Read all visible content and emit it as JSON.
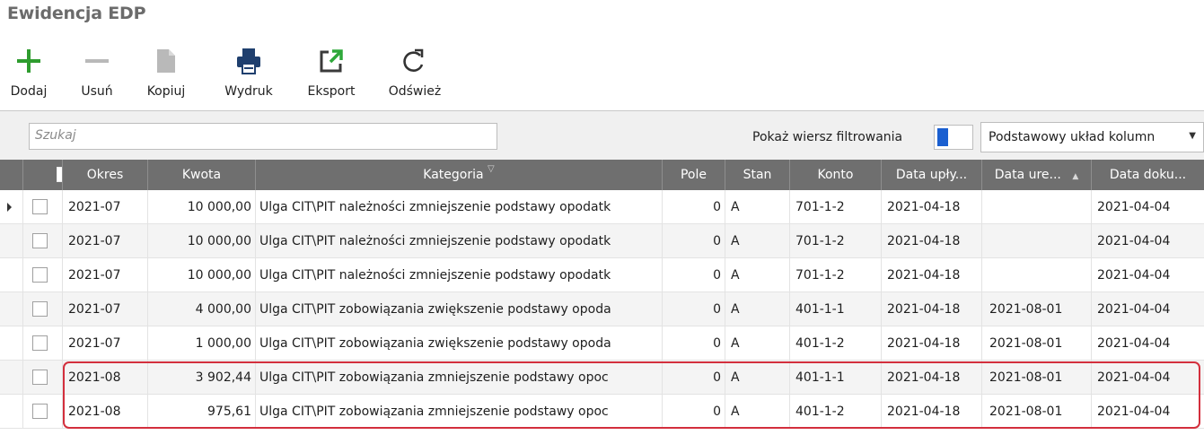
{
  "title": "Ewidencja EDP",
  "toolbar": {
    "add_label": "Dodaj",
    "delete_label": "Usuń",
    "copy_label": "Kopiuj",
    "print_label": "Wydruk",
    "export_label": "Eksport",
    "refresh_label": "Odśwież"
  },
  "search": {
    "placeholder": "Szukaj"
  },
  "filter": {
    "label": "Pokaż wiersz filtrowania"
  },
  "layout": {
    "selected": "Podstawowy układ kolumn"
  },
  "columns": {
    "okres": "Okres",
    "kwota": "Kwota",
    "kategoria": "Kategoria",
    "pole": "Pole",
    "stan": "Stan",
    "konto": "Konto",
    "data_uply": "Data upły...",
    "data_ure": "Data ure...",
    "data_doku": "Data doku..."
  },
  "rows": [
    {
      "okres": "2021-07",
      "kwota": "10 000,00",
      "kategoria": "Ulga CIT\\PIT należności zmniejszenie podstawy opodatk",
      "pole": "0",
      "stan": "A",
      "konto": "701-1-2",
      "data_uply": "2021-04-18",
      "data_ure": "",
      "data_doku": "2021-04-04"
    },
    {
      "okres": "2021-07",
      "kwota": "10 000,00",
      "kategoria": "Ulga CIT\\PIT należności zmniejszenie podstawy opodatk",
      "pole": "0",
      "stan": "A",
      "konto": "701-1-2",
      "data_uply": "2021-04-18",
      "data_ure": "",
      "data_doku": "2021-04-04"
    },
    {
      "okres": "2021-07",
      "kwota": "10 000,00",
      "kategoria": "Ulga CIT\\PIT należności zmniejszenie podstawy opodatk",
      "pole": "0",
      "stan": "A",
      "konto": "701-1-2",
      "data_uply": "2021-04-18",
      "data_ure": "",
      "data_doku": "2021-04-04"
    },
    {
      "okres": "2021-07",
      "kwota": "4 000,00",
      "kategoria": "Ulga CIT\\PIT zobowiązania zwiększenie podstawy opoda",
      "pole": "0",
      "stan": "A",
      "konto": "401-1-1",
      "data_uply": "2021-04-18",
      "data_ure": "2021-08-01",
      "data_doku": "2021-04-04"
    },
    {
      "okres": "2021-07",
      "kwota": "1 000,00",
      "kategoria": "Ulga CIT\\PIT zobowiązania zwiększenie podstawy opoda",
      "pole": "0",
      "stan": "A",
      "konto": "401-1-2",
      "data_uply": "2021-04-18",
      "data_ure": "2021-08-01",
      "data_doku": "2021-04-04"
    },
    {
      "okres": "2021-08",
      "kwota": "3 902,44",
      "kategoria": "Ulga CIT\\PIT zobowiązania zmniejszenie podstawy opoc",
      "pole": "0",
      "stan": "A",
      "konto": "401-1-1",
      "data_uply": "2021-04-18",
      "data_ure": "2021-08-01",
      "data_doku": "2021-04-04"
    },
    {
      "okres": "2021-08",
      "kwota": "975,61",
      "kategoria": "Ulga CIT\\PIT zobowiązania zmniejszenie podstawy opoc",
      "pole": "0",
      "stan": "A",
      "konto": "401-1-2",
      "data_uply": "2021-04-18",
      "data_ure": "2021-08-01",
      "data_doku": "2021-04-04"
    }
  ],
  "colors": {
    "add_icon": "#2e9c2e",
    "export_icon": "#2ea83a",
    "header_bg": "#6f6f6f",
    "highlight": "#d32f3d",
    "filter_toggle": "#1a5fd0"
  }
}
